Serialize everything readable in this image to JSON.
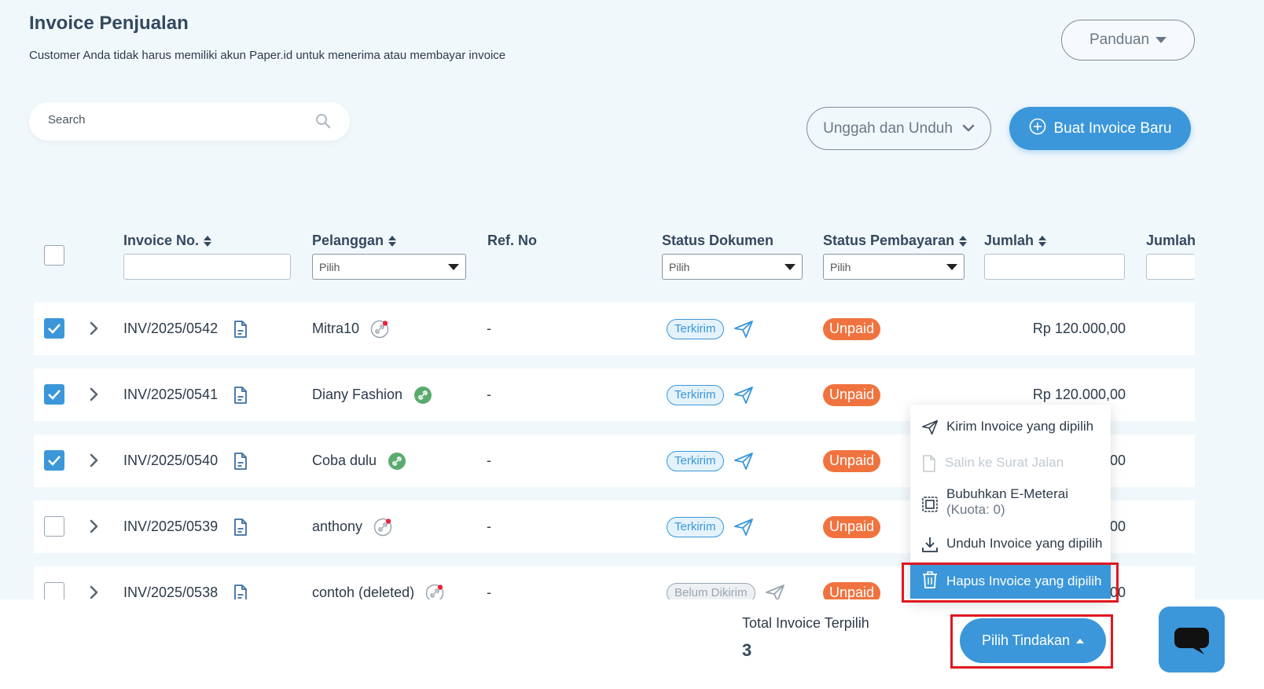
{
  "header": {
    "title": "Invoice Penjualan",
    "subtitle": "Customer Anda tidak harus memiliki akun Paper.id untuk menerima atau membayar invoice",
    "panduan_label": "Panduan"
  },
  "search": {
    "placeholder": "Search",
    "icon": "search-icon"
  },
  "actions": {
    "upload_download_label": "Unggah dan Unduh",
    "create_label": "Buat Invoice Baru"
  },
  "table": {
    "columns": {
      "invoice_no": "Invoice No.",
      "pelanggan": "Pelanggan",
      "ref_no": "Ref. No",
      "status_dokumen": "Status Dokumen",
      "status_pembayaran": "Status Pembayaran",
      "jumlah": "Jumlah",
      "jumlah_t": "Jumlah T"
    },
    "filter_placeholder": "Pilih",
    "rows": [
      {
        "checked": true,
        "invoice_no": "INV/2025/0542",
        "pelanggan": "Mitra10",
        "link_status": "inactive",
        "ref_no": "-",
        "status_dokumen": "Terkirim",
        "status_pembayaran": "Unpaid",
        "jumlah": "Rp 120.000,00"
      },
      {
        "checked": true,
        "invoice_no": "INV/2025/0541",
        "pelanggan": "Diany Fashion",
        "link_status": "active",
        "ref_no": "-",
        "status_dokumen": "Terkirim",
        "status_pembayaran": "Unpaid",
        "jumlah": "Rp 120.000,00"
      },
      {
        "checked": true,
        "invoice_no": "INV/2025/0540",
        "pelanggan": "Coba dulu",
        "link_status": "active",
        "ref_no": "-",
        "status_dokumen": "Terkirim",
        "status_pembayaran": "Unpaid",
        "jumlah": "00"
      },
      {
        "checked": false,
        "invoice_no": "INV/2025/0539",
        "pelanggan": "anthony",
        "link_status": "inactive",
        "ref_no": "-",
        "status_dokumen": "Terkirim",
        "status_pembayaran": "Unpaid",
        "jumlah": "00"
      },
      {
        "checked": false,
        "invoice_no": "INV/2025/0538",
        "pelanggan": "contoh (deleted)",
        "link_status": "inactive",
        "ref_no": "-",
        "status_dokumen": "Belum Dikirim",
        "status_pembayaran": "Unpaid",
        "jumlah": "00"
      }
    ]
  },
  "action_menu": {
    "items": [
      {
        "label": "Kirim Invoice yang dipilih",
        "icon": "send-icon",
        "state": "enabled"
      },
      {
        "label": "Salin ke Surat Jalan",
        "icon": "document-icon",
        "state": "disabled"
      },
      {
        "label": "Bubuhkan E-Meterai",
        "sublabel": "(Kuota: 0)",
        "icon": "stamp-icon",
        "state": "enabled"
      },
      {
        "label": "Unduh Invoice yang dipilih",
        "icon": "download-icon",
        "state": "enabled"
      },
      {
        "label": "Hapus Invoice yang dipilih",
        "icon": "trash-icon",
        "state": "highlighted"
      }
    ]
  },
  "footer": {
    "total_label": "Total Invoice Terpilih",
    "total_value": "3",
    "action_button_label": "Pilih Tindakan"
  },
  "colors": {
    "primary": "#3b97d9",
    "unpaid": "#f0733f",
    "highlight_box": "#e0181f",
    "background": "#f1f8fc"
  }
}
